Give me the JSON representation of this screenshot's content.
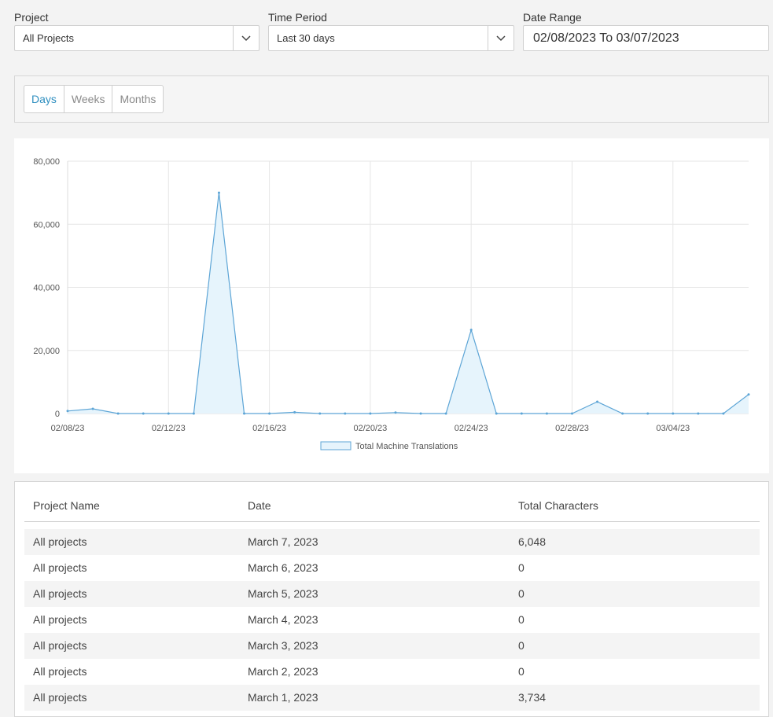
{
  "filters": {
    "project": {
      "label": "Project",
      "value": "All Projects"
    },
    "time_period": {
      "label": "Time Period",
      "value": "Last 30 days"
    },
    "date_range": {
      "label": "Date Range",
      "value": "02/08/2023 To 03/07/2023"
    }
  },
  "grouping": {
    "buttons": [
      "Days",
      "Weeks",
      "Months"
    ],
    "active": "Days"
  },
  "colors": {
    "accent": "#2f8fc0",
    "series_line": "#5da5d6",
    "series_fill": "#e6f4fc"
  },
  "chart_data": {
    "type": "area",
    "x": [
      "02/08/23",
      "02/09/23",
      "02/10/23",
      "02/11/23",
      "02/12/23",
      "02/13/23",
      "02/14/23",
      "02/15/23",
      "02/16/23",
      "02/17/23",
      "02/18/23",
      "02/19/23",
      "02/20/23",
      "02/21/23",
      "02/22/23",
      "02/23/23",
      "02/24/23",
      "02/25/23",
      "02/26/23",
      "02/27/23",
      "02/28/23",
      "03/01/23",
      "03/02/23",
      "03/03/23",
      "03/04/23",
      "03/05/23",
      "03/06/23",
      "03/07/23"
    ],
    "x_tick_labels": [
      "02/08/23",
      "02/12/23",
      "02/16/23",
      "02/20/23",
      "02/24/23",
      "02/28/23",
      "03/04/23"
    ],
    "series": [
      {
        "name": "Total Machine Translations",
        "values": [
          800,
          1500,
          0,
          0,
          0,
          0,
          70000,
          0,
          0,
          400,
          0,
          0,
          0,
          300,
          0,
          0,
          26500,
          0,
          0,
          0,
          0,
          3734,
          0,
          0,
          0,
          0,
          0,
          6048
        ]
      }
    ],
    "y_ticks": [
      "0",
      "20,000",
      "40,000",
      "60,000",
      "80,000"
    ],
    "ylim": [
      0,
      80000
    ],
    "grid": true,
    "legend": "bottom"
  },
  "table": {
    "headers": [
      "Project Name",
      "Date",
      "Total Characters"
    ],
    "rows": [
      [
        "All projects",
        "March 7, 2023",
        "6,048"
      ],
      [
        "All projects",
        "March 6, 2023",
        "0"
      ],
      [
        "All projects",
        "March 5, 2023",
        "0"
      ],
      [
        "All projects",
        "March 4, 2023",
        "0"
      ],
      [
        "All projects",
        "March 3, 2023",
        "0"
      ],
      [
        "All projects",
        "March 2, 2023",
        "0"
      ],
      [
        "All projects",
        "March 1, 2023",
        "3,734"
      ]
    ]
  }
}
